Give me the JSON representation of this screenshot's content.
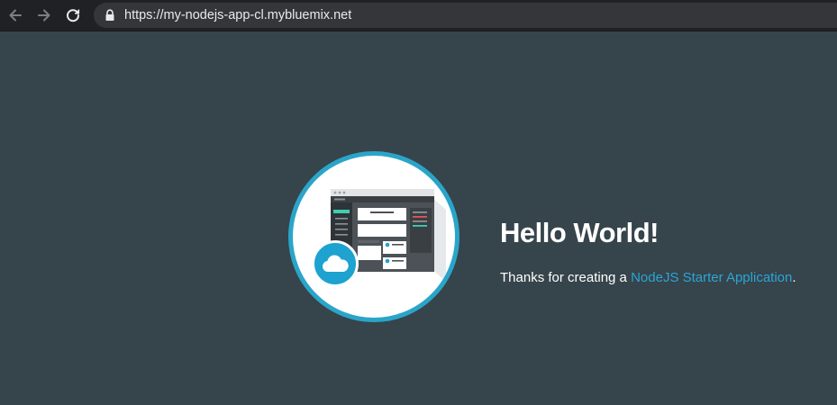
{
  "browser": {
    "url": "https://my-nodejs-app-cl.mybluemix.net",
    "back_icon": "arrow-left-icon",
    "forward_icon": "arrow-right-icon",
    "reload_icon": "reload-icon",
    "lock_icon": "lock-icon"
  },
  "page": {
    "background_color": "#36444b",
    "logo": {
      "icon": "app-dashboard-illustration",
      "badge_icon": "cloud-icon",
      "ring_color": "#2aa5c9"
    },
    "headline": "Hello World!",
    "message": {
      "prefix": "Thanks for creating a ",
      "link_text": "NodeJS Starter Application",
      "suffix": ".",
      "link_color": "#2ba6d6"
    }
  }
}
